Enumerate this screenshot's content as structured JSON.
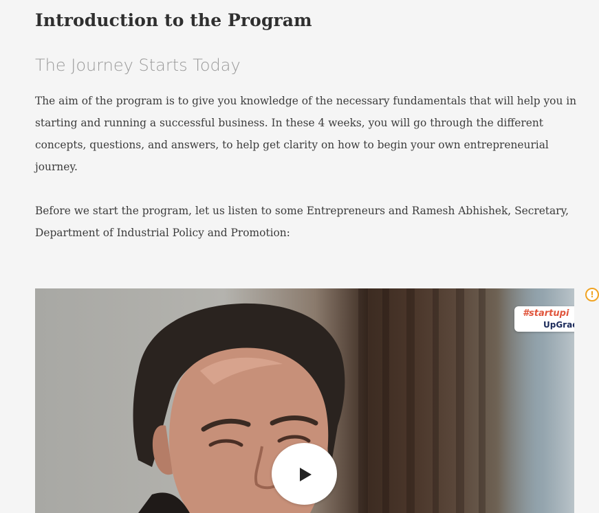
{
  "page": {
    "title": "Introduction to the Program",
    "subtitle": "The Journey Starts Today",
    "paragraphs": [
      "The aim of the program is to give you knowledge of the necessary fundamentals that will help you in starting and running a successful business. In these 4 weeks, you will go through the different concepts, questions, and answers, to help get clarity on how to begin your own entrepreneurial journey.",
      "Before we start the program, let us listen to some Entrepreneurs and Ramesh Abhishek, Secretary, Department of Industrial Policy and Promotion:"
    ]
  },
  "video": {
    "overlay_hashtag": "#startupi",
    "overlay_brand": "UpGrad",
    "play_icon": "play-icon"
  },
  "side": {
    "alert_icon": "alert-icon",
    "alert_glyph": "!"
  },
  "colors": {
    "background": "#f5f5f5",
    "title": "#2f2f2f",
    "subtitle": "#9a9a9a",
    "body_text": "#3c3c3c",
    "alert": "#f0a322",
    "hashtag": "#e0553c",
    "brand": "#1b2a5a"
  }
}
